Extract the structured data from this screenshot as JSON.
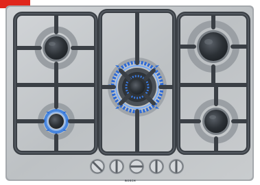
{
  "scene": {
    "subject": "gas-hob",
    "brand_label": "BOSCH",
    "burner_count": 5,
    "lit_burners": [
      "front-left-burner",
      "center-wok-burner"
    ],
    "control_knob_count": 5,
    "colors": {
      "steel_surface": "#c4c7ca",
      "cast_iron_grate": "#3a3f45",
      "burner_cap": "#2b3035",
      "flame_blue": "#3b7fe0",
      "corner_tab": "#e0261c"
    }
  }
}
